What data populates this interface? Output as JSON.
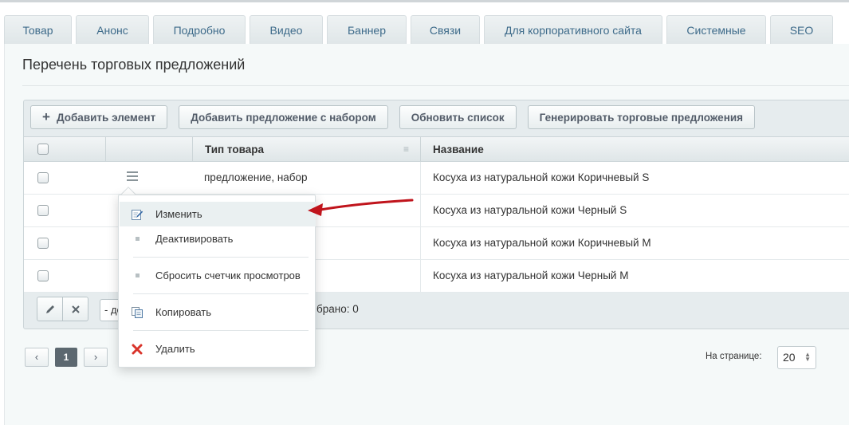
{
  "tabs": [
    {
      "label": "Товар",
      "active": true
    },
    {
      "label": "Анонс"
    },
    {
      "label": "Подробно"
    },
    {
      "label": "Видео"
    },
    {
      "label": "Баннер"
    },
    {
      "label": "Связи"
    },
    {
      "label": "Для корпоративного сайта"
    },
    {
      "label": "Системные"
    },
    {
      "label": "SEO"
    }
  ],
  "section": {
    "title": "Перечень торговых предложений"
  },
  "toolbar": {
    "add_element": "Добавить элемент",
    "add_with_set": "Добавить предложение с набором",
    "refresh": "Обновить список",
    "generate": "Генерировать торговые предложения"
  },
  "grid": {
    "columns": {
      "type": "Тип товара",
      "name": "Название"
    },
    "rows": [
      {
        "type": "предложение, набор",
        "name": "Косуха из натуральной кожи Коричневый S"
      },
      {
        "type": "",
        "name": "Косуха из натуральной кожи Черный S"
      },
      {
        "type": "",
        "name": "Косуха из натуральной кожи Коричневый M"
      },
      {
        "type": "",
        "name": "Косуха из натуральной кожи Черный M"
      }
    ]
  },
  "actionbar": {
    "select_value": "- де",
    "selected_text": "брано: 0"
  },
  "pager": {
    "prev": "‹",
    "current": "1",
    "next": "›",
    "per_page_label": "На странице:",
    "per_page_value": "20"
  },
  "context_menu": {
    "items": [
      {
        "label": "Изменить",
        "icon": "edit-icon"
      },
      {
        "label": "Деактивировать",
        "icon": "dot-icon"
      },
      {
        "label": "Сбросить счетчик просмотров",
        "icon": "dot-icon"
      },
      {
        "label": "Копировать",
        "icon": "copy-icon"
      },
      {
        "label": "Удалить",
        "icon": "delete-icon"
      }
    ]
  },
  "colors": {
    "tab_text": "#3e6b8a",
    "annotation_arrow": "#c0141c",
    "delete_icon": "#d9342b"
  }
}
